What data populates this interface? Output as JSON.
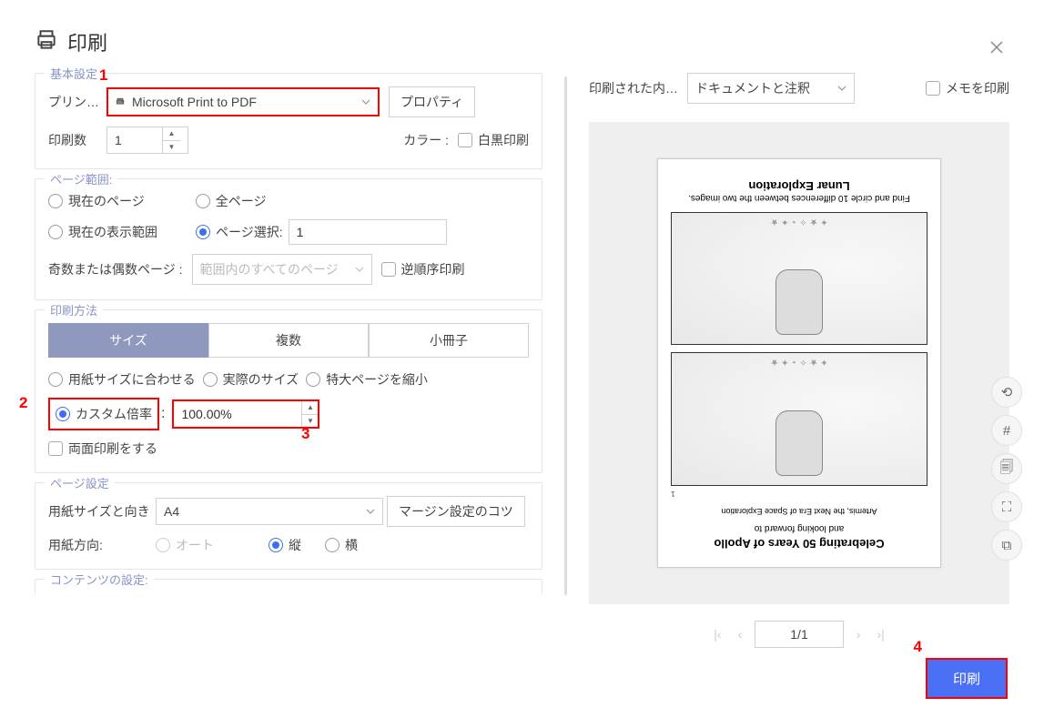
{
  "header": {
    "title": "印刷"
  },
  "annotations": {
    "a1": "1",
    "a2": "2",
    "a3": "3",
    "a4": "4"
  },
  "basic": {
    "legend": "基本設定",
    "printer_label": "プリン…",
    "printer_name": "Microsoft Print to PDF",
    "properties": "プロパティ",
    "copies_label": "印刷数",
    "copies": "1",
    "color_label": "カラー :",
    "bw_label": "白黒印刷"
  },
  "range": {
    "legend": "ページ範囲:",
    "current": "現在のページ",
    "all": "全ページ",
    "view": "現在の表示範囲",
    "select": "ページ選択:",
    "select_value": "1",
    "odd_even_label": "奇数または偶数ページ :",
    "subset": "範囲内のすべてのページ",
    "reverse": "逆順序印刷"
  },
  "method": {
    "legend": "印刷方法",
    "tab_size": "サイズ",
    "tab_multi": "複数",
    "tab_book": "小冊子",
    "fit": "用紙サイズに合わせる",
    "actual": "実際のサイズ",
    "shrink": "特大ページを縮小",
    "custom": "カスタム倍率",
    "custom_value": "100.00%",
    "duplex": "両面印刷をする"
  },
  "page": {
    "legend": "ページ設定",
    "size_label": "用紙サイズと向き",
    "size_value": "A4",
    "margin": "マージン設定のコツ",
    "orient_label": "用紙方向:",
    "auto": "オート",
    "portrait": "縦",
    "landscape": "横"
  },
  "content": {
    "legend": "コンテンツの設定:"
  },
  "right": {
    "content_label": "印刷された内…",
    "content_value": "ドキュメントと注釈",
    "memo": "メモを印刷",
    "preview": {
      "title": "Lunar Exploration",
      "sub": "Find and circle 10 differences between the two images.",
      "foot_small": "and looking forward to",
      "foot_title": "Celebrating 50 Years of Apollo",
      "foot_sub": "Artemis, the Next Era of Space Exploration",
      "page_num": "1"
    },
    "pager": "1/1"
  },
  "footer": {
    "print": "印刷"
  }
}
